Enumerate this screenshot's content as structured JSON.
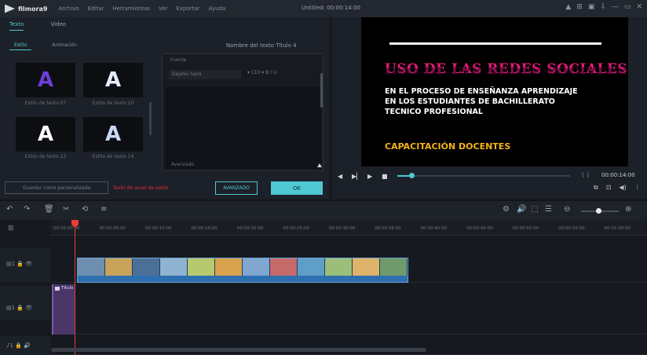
{
  "app": {
    "brand": "filmora9",
    "menu": [
      "Archivo",
      "Editar",
      "Herramientas",
      "Ver",
      "Exportar",
      "Ayuda"
    ],
    "window_title": "Untitled: 00:00:14:00",
    "controls": [
      "▲",
      "⊞",
      "▣",
      "⇩",
      "—",
      "▭",
      "✕"
    ]
  },
  "editor": {
    "tabs": [
      "Texto",
      "Video"
    ],
    "subtabs": [
      "Estilo",
      "Animación"
    ],
    "presets": [
      {
        "glyph": "A",
        "color": "#6d3fd8",
        "label": "Estilo de texto 07"
      },
      {
        "glyph": "A",
        "color": "#e6eefc",
        "label": "Estilo de texto 10"
      },
      {
        "glyph": "A",
        "color": "#ffffff",
        "label": "Estilo de texto 12"
      },
      {
        "glyph": "A",
        "color": "#c9d6f5",
        "label": "Estilo de texto 14"
      }
    ],
    "settings_title": "Nombre del texto Título 4",
    "field_label": "Fuente",
    "font_value": "DejaVu Sans",
    "size_value": "▾  110  ▾   B  I  U",
    "advanced_label": "Avanzado",
    "save_custom_label": "Guardar como personalizado",
    "warning": "Texto de aviso de estilo",
    "advanced_button": "AVANZADO",
    "ok_button": "OK"
  },
  "preview": {
    "heading": "USO DE LAS REDES SOCIALES",
    "body_lines": [
      "EN EL PROCESO DE ENSEÑANZA APRENDIZAJE",
      "EN LOS ESTUDIANTES DE BACHILLERATO",
      "TECNICO PROFESIONAL"
    ],
    "footer": "CAPACITACIÓN DOCENTES",
    "timecode_brackets": "{  }",
    "timecode": "00:00:14:00",
    "progress_fraction": 0.08,
    "tool_icons": [
      "⧉",
      "⊡",
      "◀)",
      "⋮"
    ],
    "colors": {
      "heading": "#e51b7a",
      "footer": "#f2b31a",
      "accent": "#4ec9d2"
    }
  },
  "timeline": {
    "toolbar_left": [
      "↶",
      "↷",
      "🗑",
      "✂",
      "⟲",
      "≡"
    ],
    "toolbar_right": [
      "⚙",
      "🔊",
      "⬚",
      "☰",
      "⊖",
      "⊕"
    ],
    "zoom_fraction": 0.45,
    "ruler_labels": [
      "00:00:00:00",
      "00:00:05:00",
      "00:00:10:00",
      "00:00:15:00",
      "00:00:20:00",
      "00:00:25:00",
      "00:00:30:00",
      "00:00:35:00",
      "00:00:40:00",
      "00:00:45:00",
      "00:00:50:00",
      "00:00:55:00",
      "00:01:00:00"
    ],
    "track_heads": [
      "▤1 🔒 👁",
      "▤1 🔒 👁",
      "♪1 🔒 🔊"
    ],
    "title_clip_label": "Título"
  }
}
